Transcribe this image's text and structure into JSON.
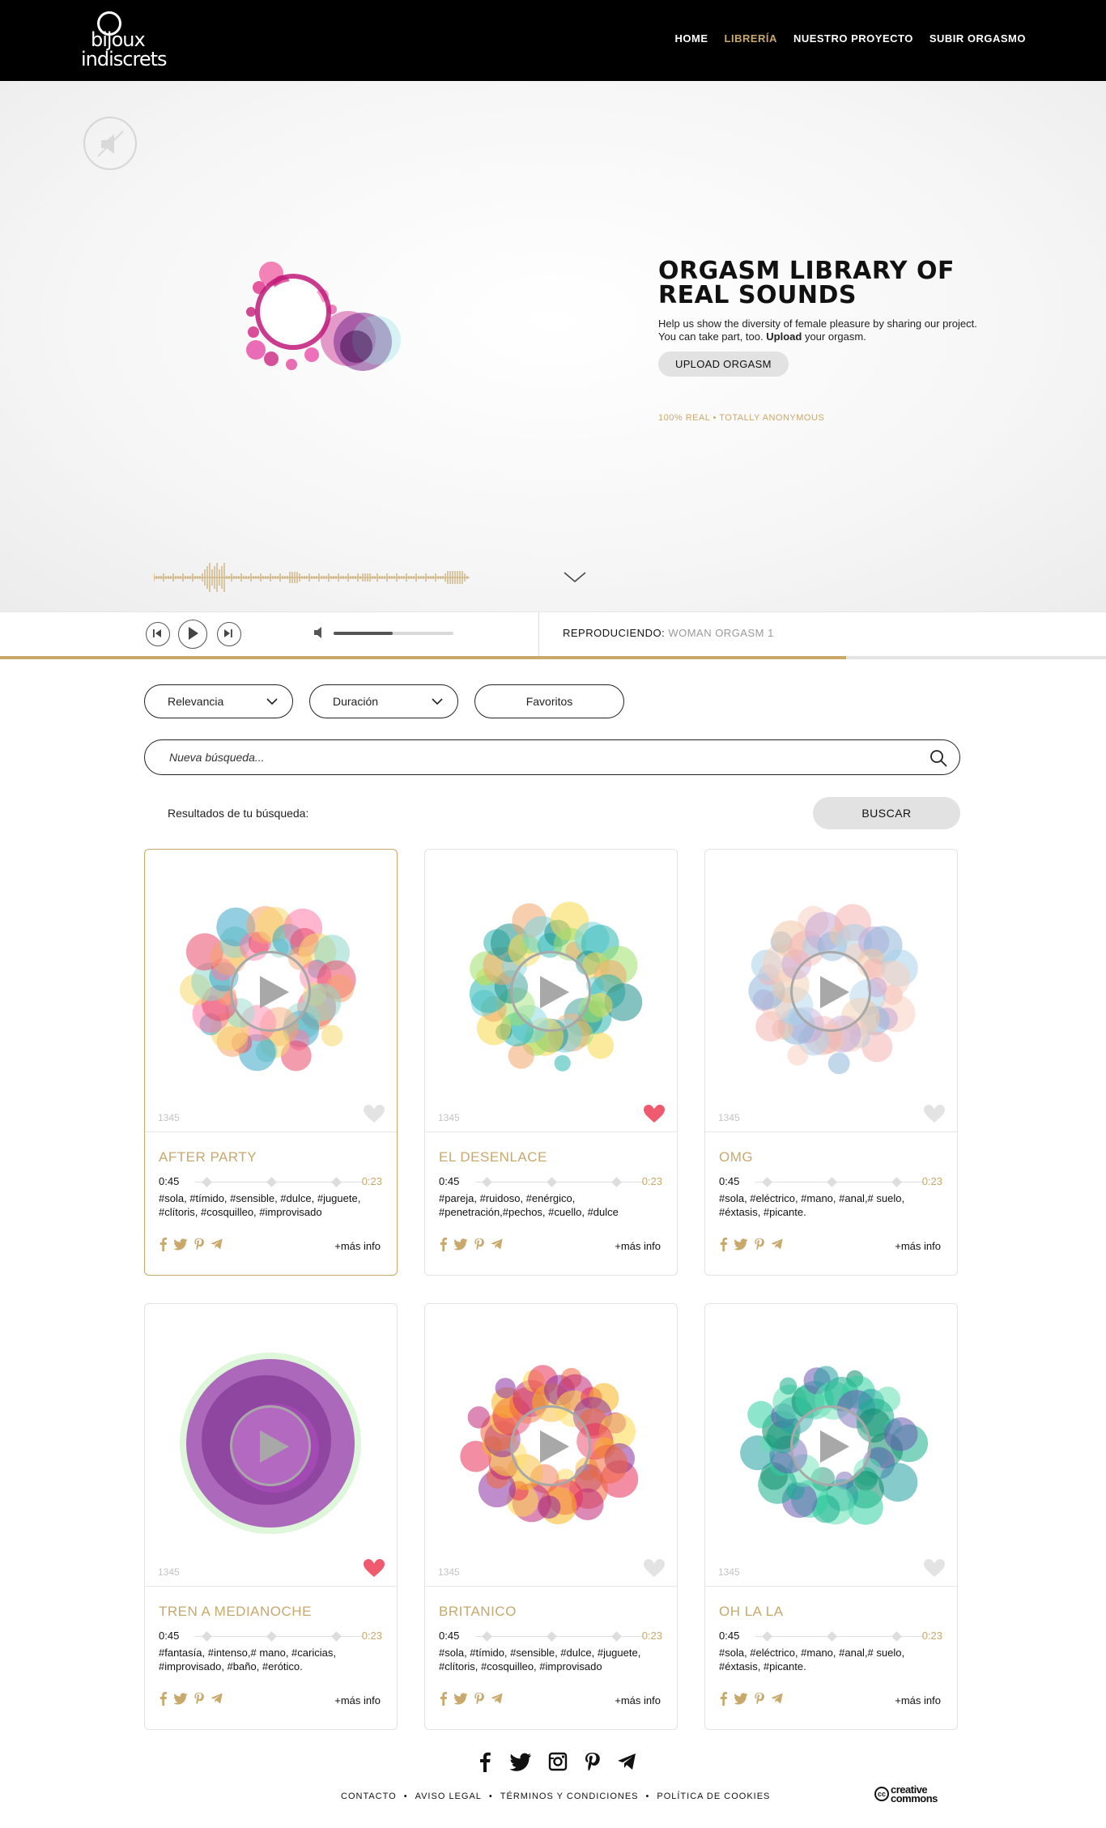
{
  "brand": {
    "line1": "bijoux",
    "line2": "indiscrets"
  },
  "nav": {
    "items": [
      {
        "label": "HOME"
      },
      {
        "label": "LIBRERÍA"
      },
      {
        "label": "NUESTRO PROYECTO"
      },
      {
        "label": "SUBIR ORGASMO"
      }
    ],
    "active_index": 1
  },
  "hero": {
    "title": "ORGASM LIBRARY OF REAL SOUNDS",
    "desc_1": "Help us show the diversity of female pleasure by sharing our project.",
    "desc_2_prefix": "You can take part, too.",
    "desc_2_bold": "Upload",
    "desc_2_suffix": "your orgasm.",
    "button": "UPLOAD ORGASM",
    "tagline": "100% REAL • TOTALLY ANONYMOUS"
  },
  "player": {
    "now_label": "REPRODUCIENDO:",
    "now_track": "WOMAN ORGASM 1",
    "volume": 0.49,
    "progress": 0.765
  },
  "filters": {
    "sort": "Relevancia",
    "duration": "Duración",
    "favorites": "Favoritos"
  },
  "search": {
    "placeholder": "Nueva búsqueda...",
    "results_label": "Resultados de tu búsqueda:",
    "button": "BUSCAR"
  },
  "cards": [
    {
      "title": "AFTER PARTY",
      "plays": "1345",
      "time_elapsed": "0:45",
      "time_total": "0:23",
      "tags_1": "#sola, #tímido, #sensible, #dulce, #juguete,",
      "tags_2": "#clítoris, #cosquilleo, #improvisado",
      "more": "+más info",
      "favorite": false,
      "selected": true,
      "colors": [
        "#e84b6a",
        "#f7a26b",
        "#f5d96b",
        "#8ed6c9",
        "#3aa6c9",
        "#ff7aa5"
      ]
    },
    {
      "title": "EL DESENLACE",
      "plays": "1345",
      "time_elapsed": "0:45",
      "time_total": "0:23",
      "tags_1": "#pareja, #ruidoso, #enérgico,",
      "tags_2": "#penetración,#pechos, #cuello, #dulce",
      "more": "+más info",
      "favorite": true,
      "selected": false,
      "colors": [
        "#2cb7b0",
        "#1f8f8a",
        "#f7d94a",
        "#9ee06b",
        "#f0a86b",
        "#79d3e0"
      ]
    },
    {
      "title": "OMG",
      "plays": "1345",
      "time_elapsed": "0:45",
      "time_total": "0:23",
      "tags_1": "#sola, #eléctrico, #mano, #anal,# suelo,",
      "tags_2": "#éxtasis, #picante.",
      "more": "+más info",
      "favorite": false,
      "selected": false,
      "colors": [
        "#f4b3b0",
        "#a9d1ea",
        "#f7d0c0",
        "#c7a7d6",
        "#8fb7d9",
        "#f0c9a5"
      ]
    },
    {
      "title": "TREN A MEDIANOCHE",
      "plays": "1345",
      "time_elapsed": "0:45",
      "time_total": "0:23",
      "tags_1": "#fantasía, #intenso,# mano, #caricias,",
      "tags_2": "#improvisado, #baño, #erótico.",
      "more": "+más info",
      "favorite": true,
      "selected": false,
      "colors": [
        "#7a2f8f",
        "#b04bc0",
        "#5f2c8a",
        "#d070d8",
        "#9ee8a0",
        "#8a3aa0"
      ]
    },
    {
      "title": "BRITANICO",
      "plays": "1345",
      "time_elapsed": "0:45",
      "time_total": "0:23",
      "tags_1": "#sola, #tímido, #sensible, #dulce, #juguete,",
      "tags_2": "#clítoris, #cosquilleo, #improvisado",
      "more": "+más info",
      "favorite": false,
      "selected": false,
      "colors": [
        "#e8305a",
        "#f7b51e",
        "#8a2fa0",
        "#f0683a",
        "#c0287a",
        "#ffd84a"
      ]
    },
    {
      "title": "OH LA LA",
      "plays": "1345",
      "time_elapsed": "0:45",
      "time_total": "0:23",
      "tags_1": "#sola, #eléctrico, #mano, #anal,# suelo,",
      "tags_2": "#éxtasis, #picante.",
      "more": "+más info",
      "favorite": false,
      "selected": false,
      "colors": [
        "#18b08a",
        "#0f8a6a",
        "#2fd0a0",
        "#6a5ab0",
        "#23a0a0",
        "#5ee0b0"
      ]
    }
  ],
  "footer": {
    "links": [
      "CONTACTO",
      "AVISO LEGAL",
      "TÉRMINOS Y CONDICIONES",
      "POLÍTICA DE COOKIES"
    ],
    "cc_mark": "cc",
    "cc_line1": "creative",
    "cc_line2": "commons"
  },
  "colors": {
    "accent": "#c9a86b",
    "heart_active": "#f05a6e",
    "heart_inactive": "#e3e3e3"
  }
}
